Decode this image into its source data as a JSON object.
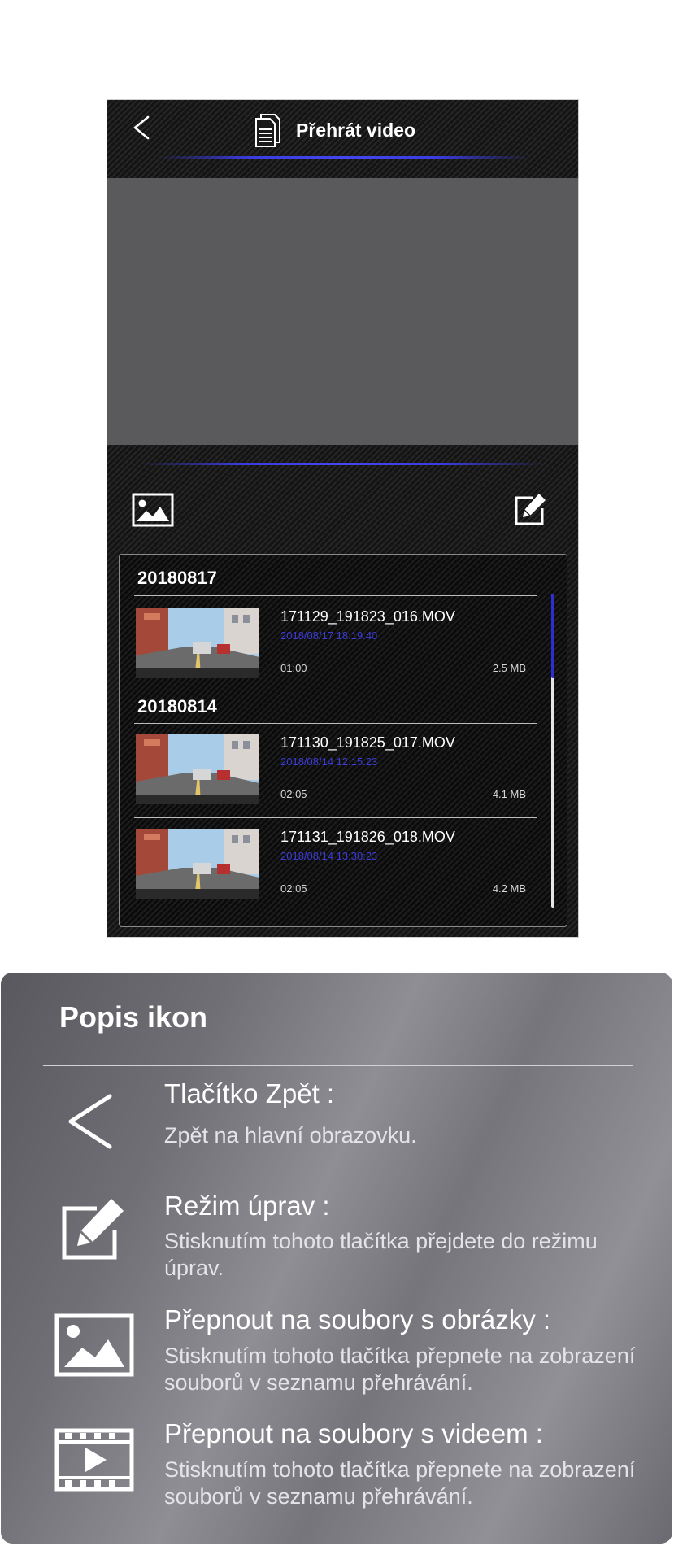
{
  "screen": {
    "header": {
      "title": "Přehrát video",
      "back_icon": "chevron-left-icon",
      "file_icon": "document-icon"
    },
    "toolbar": {
      "photo_icon": "image-icon",
      "edit_icon": "edit-icon"
    },
    "groups": [
      {
        "date": "20180817",
        "files": [
          {
            "name": "171129_191823_016.MOV",
            "datetime": "2018/08/17 18:19:40",
            "duration": "01:00",
            "size": "2.5 MB"
          }
        ]
      },
      {
        "date": "20180814",
        "files": [
          {
            "name": "171130_191825_017.MOV",
            "datetime": "2018/08/14 12:15:23",
            "duration": "02:05",
            "size": "4.1 MB"
          },
          {
            "name": "171131_191826_018.MOV",
            "datetime": "2018/08/14 13:30:23",
            "duration": "02:05",
            "size": "4.2 MB"
          }
        ]
      }
    ]
  },
  "legend": {
    "title": "Popis ikon",
    "items": [
      {
        "icon": "chevron-left-icon",
        "title": "Tlačítko Zpět :",
        "desc": "Zpět na hlavní obrazovku."
      },
      {
        "icon": "edit-icon",
        "title": "Režim úprav :",
        "desc": "Stisknutím tohoto tlačítka přejdete do režimu úprav."
      },
      {
        "icon": "image-icon",
        "title": "Přepnout na soubory s obrázky :",
        "desc": "Stisknutím tohoto tlačítka přepnete na zobrazení souborů v seznamu přehrávání."
      },
      {
        "icon": "video-icon",
        "title": "Přepnout na soubory s videem :",
        "desc": "Stisknutím tohoto tlačítka přepnete na zobrazení souborů v seznamu přehrávání."
      }
    ]
  },
  "colors": {
    "accent_blue": "#3c3cd8",
    "video_area": "#5a595b"
  }
}
